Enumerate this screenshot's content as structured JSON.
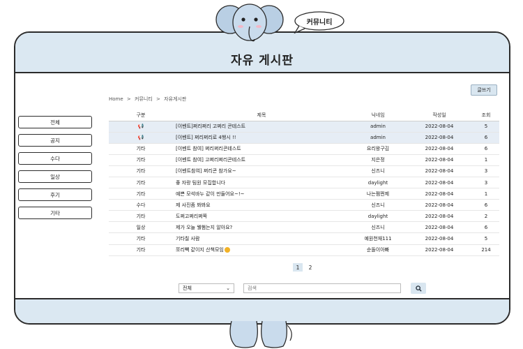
{
  "bubble": "커뮤니티",
  "board_title": "자유 게시판",
  "write_button": "글쓰기",
  "breadcrumb": [
    "Home",
    ">",
    "커뮤니티",
    ">",
    "자유게시판"
  ],
  "sidebar": [
    "전체",
    "공지",
    "수다",
    "일상",
    "후기",
    "기타"
  ],
  "table": {
    "headers": [
      "구분",
      "제목",
      "닉네임",
      "작성일",
      "조회"
    ],
    "rows": [
      {
        "cat": "",
        "title": "[이벤트]쩌리쩌리 고쩌리 콘테스트",
        "author": "admin",
        "date": "2022-08-04",
        "views": "5",
        "notice": true
      },
      {
        "cat": "",
        "title": "[이벤트] 쩌리쩌리로 4행시 !!",
        "author": "admin",
        "date": "2022-08-04",
        "views": "6",
        "notice": true
      },
      {
        "cat": "기타",
        "title": "[이벤트 참여] 쩌리쩌리콘테스트",
        "author": "요리왕구김",
        "date": "2022-08-04",
        "views": "6"
      },
      {
        "cat": "기타",
        "title": "[이벤트 참여] 고쩌리쩌리콘테스트",
        "author": "지은정",
        "date": "2022-08-04",
        "views": "1"
      },
      {
        "cat": "기타",
        "title": "[이벤트참여] 쩌리콘 참가요~",
        "author": "신즈니",
        "date": "2022-08-04",
        "views": "3"
      },
      {
        "cat": "기타",
        "title": "좋 자랑 팀원 모집합니다",
        "author": "daylight",
        "date": "2022-08-04",
        "views": "3"
      },
      {
        "cat": "기타",
        "title": "예쁜 모석바누 같이 만들어요~!~",
        "author": "나는쩜쩐제",
        "date": "2022-08-04",
        "views": "1"
      },
      {
        "cat": "수다",
        "title": "제 사진좀 봐봐요",
        "author": "신즈니",
        "date": "2022-08-04",
        "views": "6"
      },
      {
        "cat": "기타",
        "title": "도쩌고쩌리쩌쪽",
        "author": "daylight",
        "date": "2022-08-04",
        "views": "2"
      },
      {
        "cat": "일상",
        "title": "제가 오늘 웰햄는지 알아요?",
        "author": "신즈니",
        "date": "2022-08-04",
        "views": "6"
      },
      {
        "cat": "기타",
        "title": "기타칠 사람",
        "author": "예원천재111",
        "date": "2022-08-04",
        "views": "5"
      },
      {
        "cat": "기타",
        "title": "쪼리빽 같이지 산책모임",
        "author": "순돌이아빠",
        "date": "2022-08-04",
        "views": "214",
        "smile": true
      }
    ]
  },
  "pagination": [
    "1",
    "2"
  ],
  "search": {
    "select_value": "전체",
    "placeholder": "검색"
  },
  "colors": {
    "header_bg": "#dbe8f2",
    "notice_row_bg": "#e6edf5",
    "accent_button": "#d9e6f0"
  }
}
